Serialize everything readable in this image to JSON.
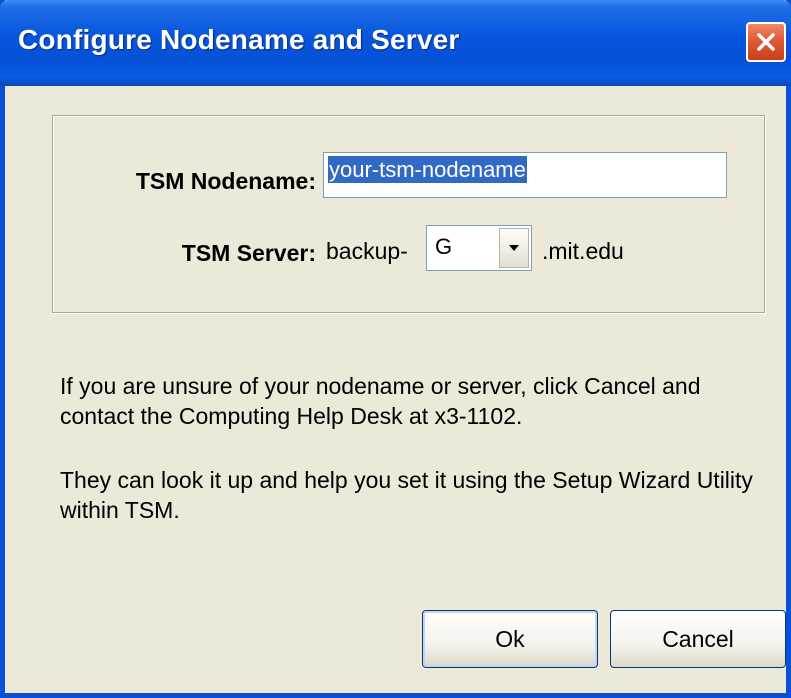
{
  "window": {
    "title": "Configure Nodename and Server"
  },
  "form": {
    "nodename_label": "TSM Nodename:",
    "nodename_value": "your-tsm-nodename",
    "server_label": "TSM Server:",
    "server_prefix": "backup-",
    "server_selected": "G",
    "server_suffix": ".mit.edu"
  },
  "info": {
    "paragraph1": "If you are unsure of your nodename or server, click Cancel and contact the Computing Help Desk at x3-1102.",
    "paragraph2": "They can look it up and help you set it using the Setup Wizard Utility within TSM."
  },
  "buttons": {
    "ok": "Ok",
    "cancel": "Cancel"
  },
  "icons": {
    "close": "close-icon",
    "dropdown": "chevron-down-icon"
  },
  "colors": {
    "titlebar": "#0856dd",
    "selection": "#316ac5",
    "close": "#e05a36",
    "dialog_bg": "#ece9d8"
  }
}
